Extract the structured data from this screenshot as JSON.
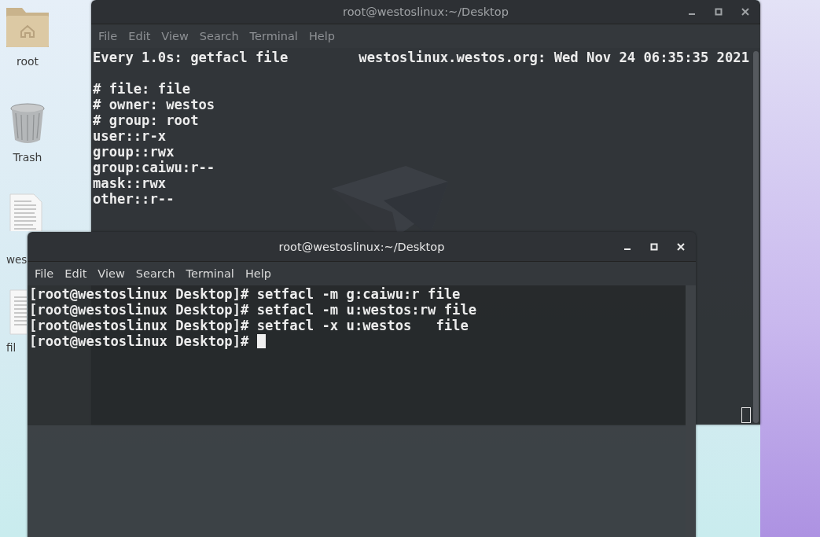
{
  "desktop_icons": [
    {
      "kind": "folder",
      "label": "root"
    },
    {
      "kind": "trash",
      "label": "Trash"
    },
    {
      "kind": "document",
      "label": "wes"
    },
    {
      "kind": "document",
      "label": "fil"
    }
  ],
  "windows": [
    {
      "title": "root@westoslinux:~/Desktop",
      "focused": false,
      "menu": [
        "File",
        "Edit",
        "View",
        "Search",
        "Terminal",
        "Help"
      ],
      "header_left": "Every 1.0s: getfacl file",
      "header_right": "westoslinux.westos.org: Wed Nov 24 06:35:35 2021",
      "lines": [
        "# file: file",
        "# owner: westos",
        "# group: root",
        "user::r-x",
        "group::rwx",
        "group:caiwu:r--",
        "mask::rwx",
        "other::r--"
      ]
    },
    {
      "title": "root@westoslinux:~/Desktop",
      "focused": true,
      "menu": [
        "File",
        "Edit",
        "View",
        "Search",
        "Terminal",
        "Help"
      ],
      "lines": [
        "[root@westoslinux Desktop]# setfacl -m g:caiwu:r file",
        "[root@westoslinux Desktop]# setfacl -m u:westos:rw file",
        "[root@westoslinux Desktop]# setfacl -x u:westos   file",
        "[root@westoslinux Desktop]# "
      ]
    }
  ]
}
